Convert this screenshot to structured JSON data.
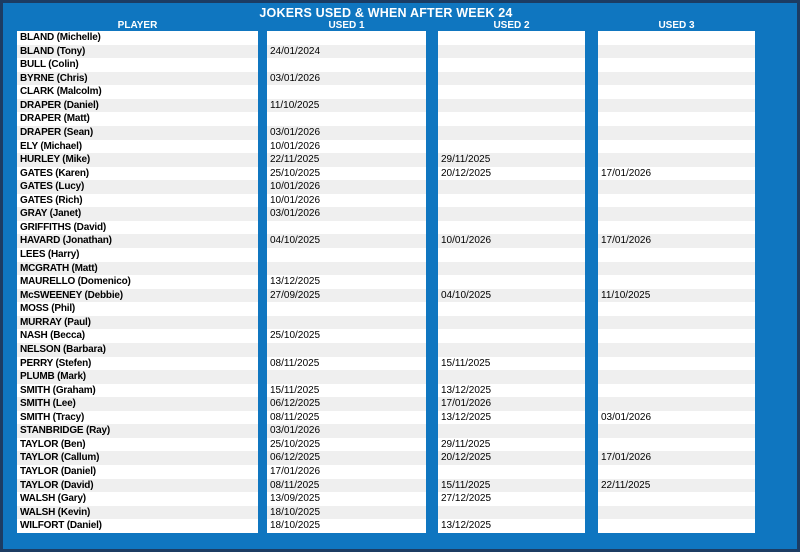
{
  "table": {
    "title": "JOKERS USED & WHEN AFTER WEEK 24",
    "columns": [
      "PLAYER",
      "USED 1",
      "USED 2",
      "USED 3"
    ],
    "rows": [
      {
        "player": "BLAND (Michelle)",
        "used1": "",
        "used2": "",
        "used3": ""
      },
      {
        "player": "BLAND (Tony)",
        "used1": "24/01/2024",
        "used2": "",
        "used3": ""
      },
      {
        "player": "BULL (Colin)",
        "used1": "",
        "used2": "",
        "used3": ""
      },
      {
        "player": "BYRNE (Chris)",
        "used1": "03/01/2026",
        "used2": "",
        "used3": ""
      },
      {
        "player": "CLARK (Malcolm)",
        "used1": "",
        "used2": "",
        "used3": ""
      },
      {
        "player": "DRAPER (Daniel)",
        "used1": "11/10/2025",
        "used2": "",
        "used3": ""
      },
      {
        "player": "DRAPER (Matt)",
        "used1": "",
        "used2": "",
        "used3": ""
      },
      {
        "player": "DRAPER (Sean)",
        "used1": "03/01/2026",
        "used2": "",
        "used3": ""
      },
      {
        "player": "ELY (Michael)",
        "used1": "10/01/2026",
        "used2": "",
        "used3": ""
      },
      {
        "player": "HURLEY (Mike)",
        "used1": "22/11/2025",
        "used2": "29/11/2025",
        "used3": ""
      },
      {
        "player": "GATES (Karen)",
        "used1": "25/10/2025",
        "used2": "20/12/2025",
        "used3": "17/01/2026"
      },
      {
        "player": "GATES (Lucy)",
        "used1": "10/01/2026",
        "used2": "",
        "used3": ""
      },
      {
        "player": "GATES (Rich)",
        "used1": "10/01/2026",
        "used2": "",
        "used3": ""
      },
      {
        "player": "GRAY (Janet)",
        "used1": "03/01/2026",
        "used2": "",
        "used3": ""
      },
      {
        "player": "GRIFFITHS (David)",
        "used1": "",
        "used2": "",
        "used3": ""
      },
      {
        "player": "HAVARD (Jonathan)",
        "used1": "04/10/2025",
        "used2": "10/01/2026",
        "used3": "17/01/2026"
      },
      {
        "player": "LEES (Harry)",
        "used1": "",
        "used2": "",
        "used3": ""
      },
      {
        "player": "MCGRATH (Matt)",
        "used1": "",
        "used2": "",
        "used3": ""
      },
      {
        "player": "MAURELLO (Domenico)",
        "used1": "13/12/2025",
        "used2": "",
        "used3": ""
      },
      {
        "player": "McSWEENEY (Debbie)",
        "used1": "27/09/2025",
        "used2": "04/10/2025",
        "used3": "11/10/2025"
      },
      {
        "player": "MOSS (Phil)",
        "used1": "",
        "used2": "",
        "used3": ""
      },
      {
        "player": "MURRAY (Paul)",
        "used1": "",
        "used2": "",
        "used3": ""
      },
      {
        "player": "NASH (Becca)",
        "used1": "25/10/2025",
        "used2": "",
        "used3": ""
      },
      {
        "player": "NELSON (Barbara)",
        "used1": "",
        "used2": "",
        "used3": ""
      },
      {
        "player": "PERRY (Stefen)",
        "used1": "08/11/2025",
        "used2": "15/11/2025",
        "used3": ""
      },
      {
        "player": "PLUMB (Mark)",
        "used1": "",
        "used2": "",
        "used3": ""
      },
      {
        "player": "SMITH (Graham)",
        "used1": "15/11/2025",
        "used2": "13/12/2025",
        "used3": ""
      },
      {
        "player": "SMITH (Lee)",
        "used1": "06/12/2025",
        "used2": "17/01/2026",
        "used3": ""
      },
      {
        "player": "SMITH (Tracy)",
        "used1": "08/11/2025",
        "used2": "13/12/2025",
        "used3": "03/01/2026"
      },
      {
        "player": "STANBRIDGE (Ray)",
        "used1": "03/01/2026",
        "used2": "",
        "used3": ""
      },
      {
        "player": "TAYLOR (Ben)",
        "used1": "25/10/2025",
        "used2": "29/11/2025",
        "used3": ""
      },
      {
        "player": "TAYLOR (Callum)",
        "used1": "06/12/2025",
        "used2": "20/12/2025",
        "used3": "17/01/2026"
      },
      {
        "player": "TAYLOR (Daniel)",
        "used1": "17/01/2026",
        "used2": "",
        "used3": ""
      },
      {
        "player": "TAYLOR (David)",
        "used1": "08/11/2025",
        "used2": "15/11/2025",
        "used3": "22/11/2025"
      },
      {
        "player": "WALSH (Gary)",
        "used1": "13/09/2025",
        "used2": "27/12/2025",
        "used3": ""
      },
      {
        "player": "WALSH (Kevin)",
        "used1": "18/10/2025",
        "used2": "",
        "used3": ""
      },
      {
        "player": "WILFORT (Daniel)",
        "used1": "18/10/2025",
        "used2": "13/12/2025",
        "used3": ""
      }
    ]
  },
  "colors": {
    "background": "#0f76c0",
    "border": "#1c3c63",
    "stripe": "#efefef",
    "cell_background": "#ffffff",
    "header_text": "#ffffff",
    "cell_text": "#000000"
  }
}
